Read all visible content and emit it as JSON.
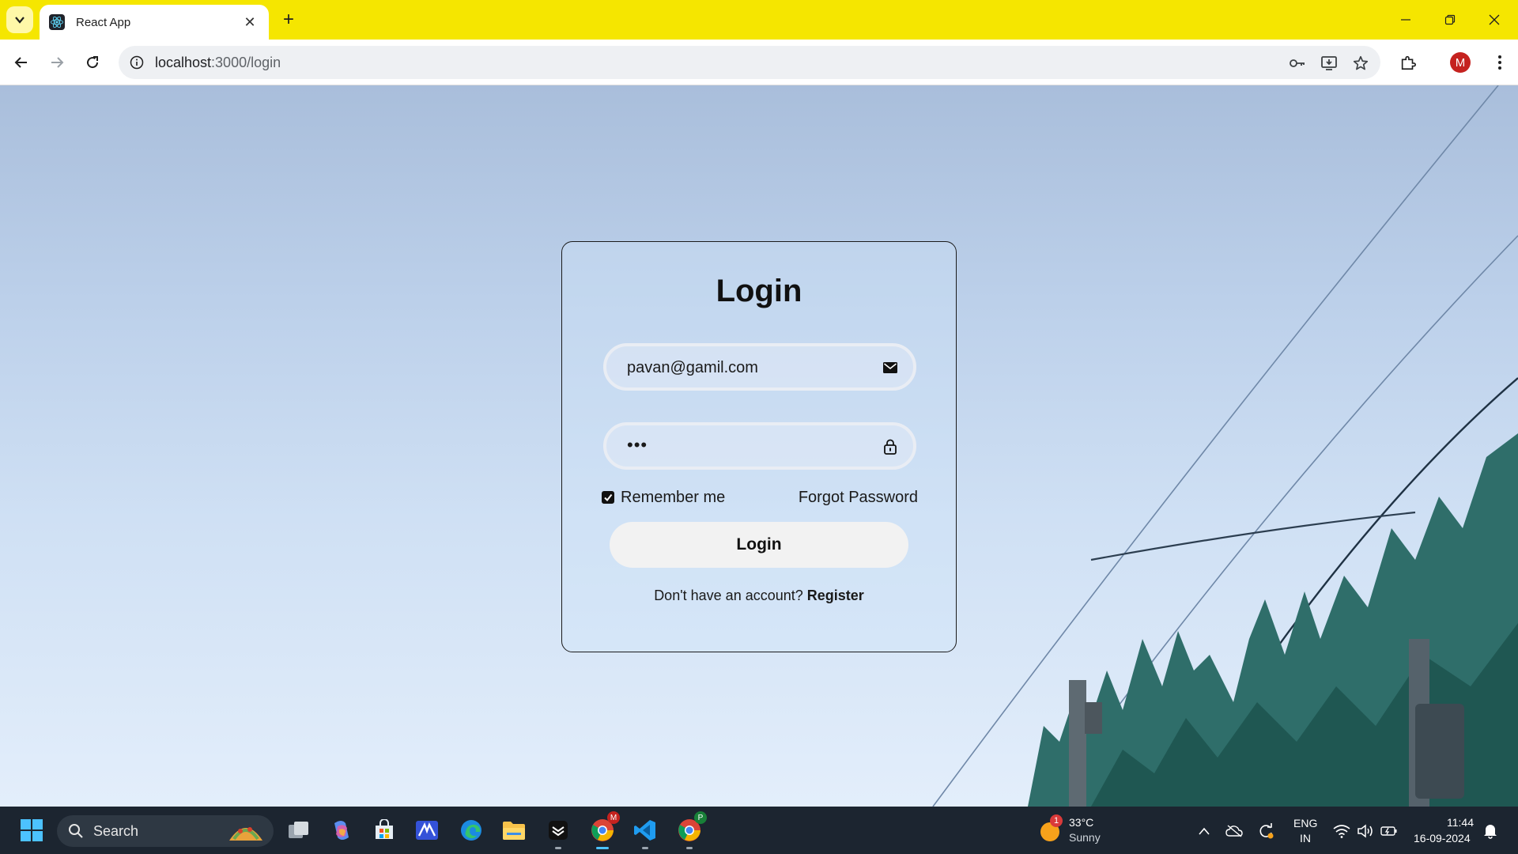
{
  "browser": {
    "tab_title": "React App",
    "tab_close": "✕",
    "new_tab": "+",
    "url_host": "localhost",
    "url_path": ":3000/login",
    "profile_initial": "M"
  },
  "login": {
    "title": "Login",
    "email_value": "pavan@gamil.com",
    "password_mask": "•••",
    "remember_label": "Remember me",
    "remember_checked": true,
    "forgot_label": "Forgot Password",
    "button_label": "Login",
    "register_prompt": "Don't have an account?",
    "register_link": "Register"
  },
  "taskbar": {
    "search_label": "Search",
    "weather_temp": "33°C",
    "weather_desc": "Sunny",
    "weather_badge": "1",
    "lang_line1": "ENG",
    "lang_line2": "IN",
    "time": "11:44",
    "date": "16-09-2024",
    "chrome_badge_1": "M",
    "chrome_badge_2": "P"
  },
  "colors": {
    "titlebar": "#f5e600",
    "taskbar": "#1c2530",
    "avatar": "#c5221f"
  }
}
